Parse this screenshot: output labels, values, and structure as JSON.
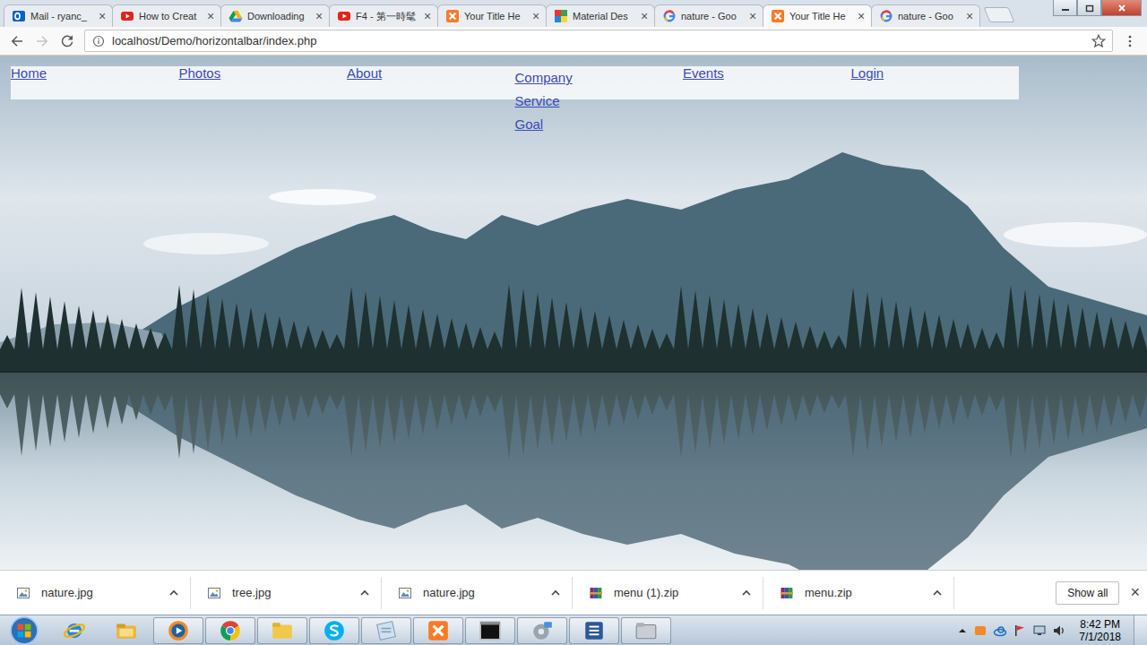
{
  "browser": {
    "tabs": [
      {
        "label": "Mail - ryanc_",
        "kind": "outlook",
        "selected": false
      },
      {
        "label": "How to Creat",
        "kind": "youtube",
        "selected": false
      },
      {
        "label": "Downloading",
        "kind": "drive",
        "selected": false
      },
      {
        "label": "F4 - 第一時髦",
        "kind": "youtube",
        "selected": false
      },
      {
        "label": "Your Title He",
        "kind": "xampp",
        "selected": false
      },
      {
        "label": "Material Des",
        "kind": "material",
        "selected": false
      },
      {
        "label": "nature - Goo",
        "kind": "google",
        "selected": false
      },
      {
        "label": "Your Title He",
        "kind": "xampp",
        "selected": true
      },
      {
        "label": "nature - Goo",
        "kind": "google",
        "selected": false
      }
    ],
    "close_glyph": "×",
    "url": "localhost/Demo/horizontalbar/index.php"
  },
  "page": {
    "nav": [
      {
        "label": "Home",
        "expanded": false,
        "submenu": []
      },
      {
        "label": "Photos",
        "expanded": false,
        "submenu": []
      },
      {
        "label": "About",
        "expanded": false,
        "submenu": []
      },
      {
        "label": "Company",
        "expanded": true,
        "submenu": [
          "Service",
          "Goal"
        ]
      },
      {
        "label": "Events",
        "expanded": false,
        "submenu": []
      },
      {
        "label": "Login",
        "expanded": false,
        "submenu": []
      }
    ]
  },
  "downloads": {
    "items": [
      {
        "name": "nature.jpg",
        "kind": "image"
      },
      {
        "name": "tree.jpg",
        "kind": "image"
      },
      {
        "name": "nature.jpg",
        "kind": "image"
      },
      {
        "name": "menu (1).zip",
        "kind": "archive"
      },
      {
        "name": "menu.zip",
        "kind": "archive"
      }
    ],
    "show_all": "Show all",
    "close": "×"
  },
  "taskbar": {
    "apps": [
      {
        "kind": "ie",
        "running": false
      },
      {
        "kind": "explorer",
        "running": false
      },
      {
        "kind": "media",
        "running": true
      },
      {
        "kind": "chrome",
        "running": true
      },
      {
        "kind": "folder",
        "running": true
      },
      {
        "kind": "skype",
        "running": true
      },
      {
        "kind": "notes",
        "running": true
      },
      {
        "kind": "xampp",
        "running": true
      },
      {
        "kind": "cmd",
        "running": true
      },
      {
        "kind": "disk",
        "running": true
      },
      {
        "kind": "word",
        "running": true
      },
      {
        "kind": "files",
        "running": true
      }
    ],
    "clock": {
      "time": "8:42 PM",
      "date": "7/1/2018"
    }
  }
}
